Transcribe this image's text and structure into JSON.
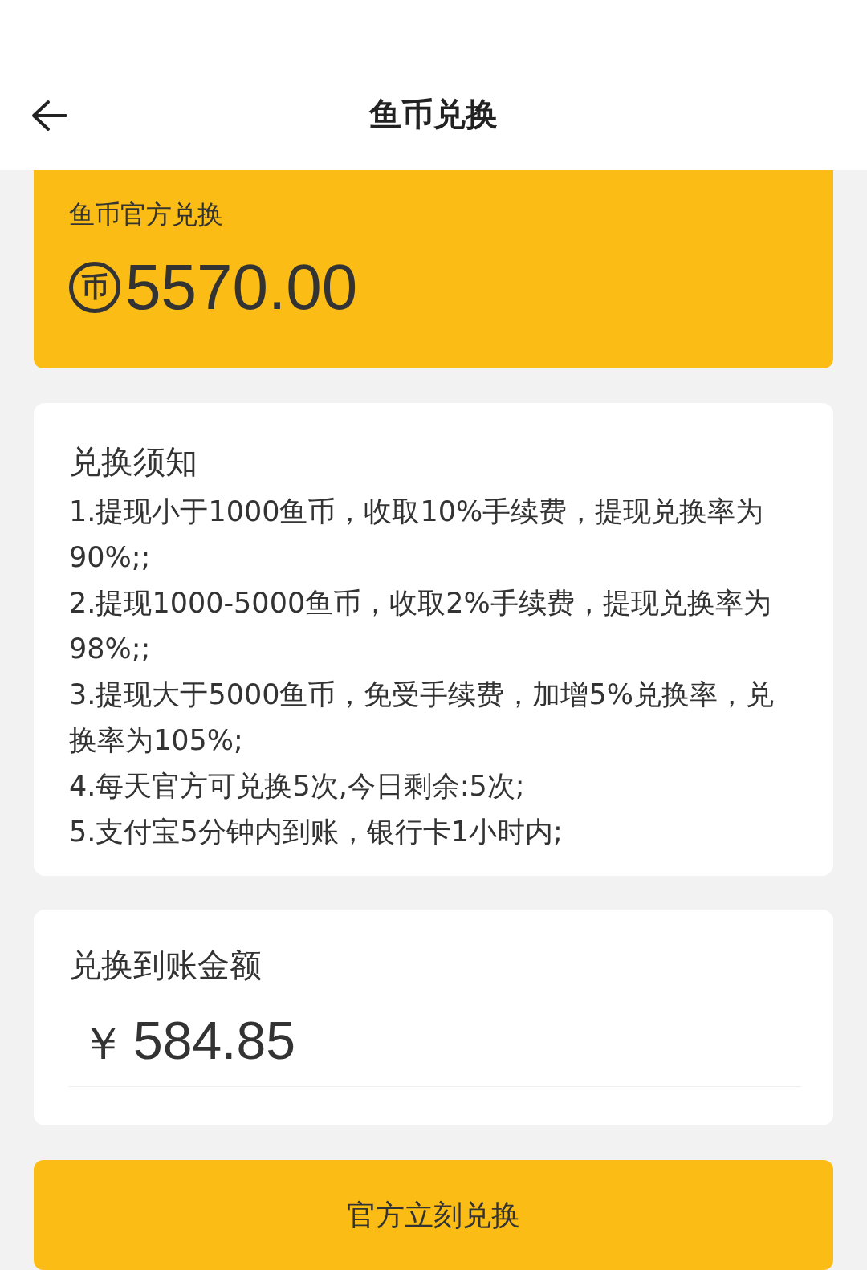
{
  "header": {
    "title": "鱼币兑换"
  },
  "balance_card": {
    "label": "鱼币官方兑换",
    "coin_symbol": "币",
    "amount": "5570.00"
  },
  "notice": {
    "title": "兑换须知",
    "lines": [
      "1.提现小于1000鱼币，收取10%手续费，提现兑换率为90%;;",
      "2.提现1000-5000鱼币，收取2%手续费，提现兑换率为98%;;",
      "3.提现大于5000鱼币，免受手续费，加增5%兑换率，兑换率为105%;",
      "4.每天官方可兑换5次,今日剩余:5次;",
      "5.支付宝5分钟内到账，银行卡1小时内;"
    ]
  },
  "payout": {
    "label": "兑换到账金额",
    "currency": "￥",
    "amount": "584.85"
  },
  "submit_button": {
    "label": "官方立刻兑换"
  }
}
